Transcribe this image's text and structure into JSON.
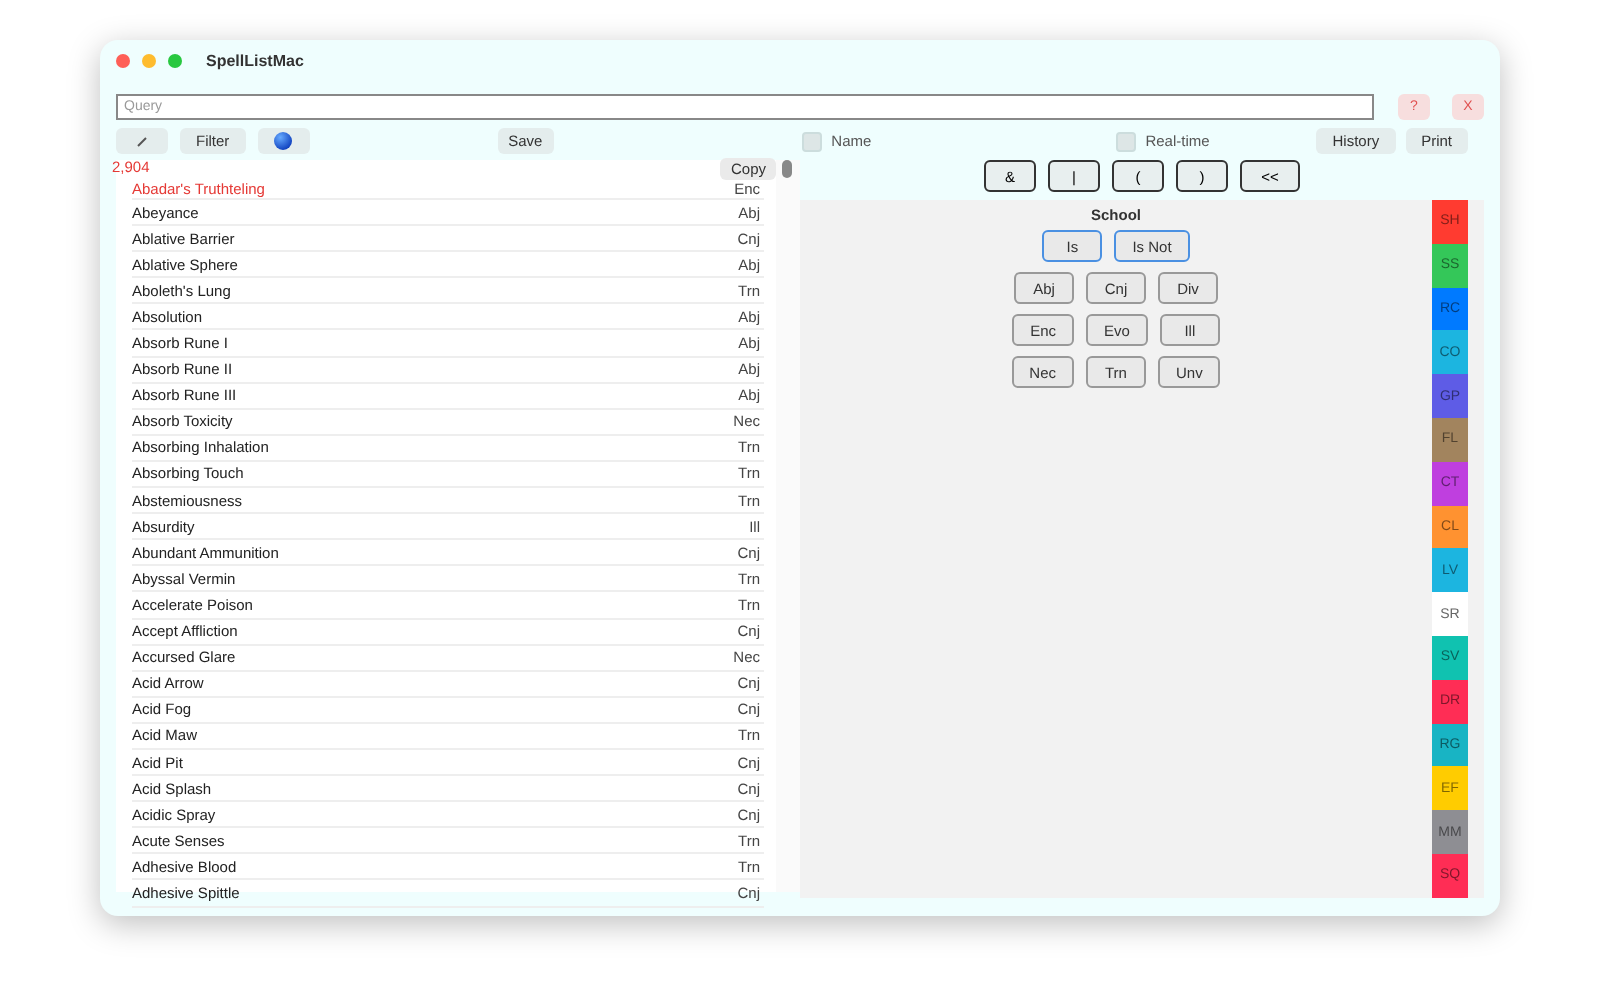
{
  "window": {
    "title": "SpellListMac"
  },
  "search": {
    "placeholder": "Query"
  },
  "search_buttons": [
    "?",
    "X"
  ],
  "toolbar": {
    "left_buttons": [
      {
        "kind": "icon"
      },
      {
        "kind": "text",
        "label": "Filter"
      },
      {
        "kind": "globe"
      }
    ],
    "save": "Save",
    "name_toggle": {
      "label": "Name",
      "checked": false
    },
    "realtime_toggle": {
      "label": "Real-time",
      "checked": false
    },
    "right_buttons": [
      "History",
      "Print"
    ]
  },
  "count": "2,904",
  "copy_button": "Copy",
  "spells": [
    {
      "name": "Abadar's Truthteling",
      "school": "Enc",
      "selected": true
    },
    {
      "name": "Abeyance",
      "school": "Abj",
      "selected": false
    },
    {
      "name": "Ablative Barrier",
      "school": "Cnj",
      "selected": false
    },
    {
      "name": "Ablative Sphere",
      "school": "Abj",
      "selected": false
    },
    {
      "name": "Aboleth's Lung",
      "school": "Trn",
      "selected": false
    },
    {
      "name": "Absolution",
      "school": "Abj",
      "selected": false
    },
    {
      "name": "Absorb Rune I",
      "school": "Abj",
      "selected": false
    },
    {
      "name": "Absorb Rune II",
      "school": "Abj",
      "selected": false
    },
    {
      "name": "Absorb Rune III",
      "school": "Abj",
      "selected": false
    },
    {
      "name": "Absorb Toxicity",
      "school": "Nec",
      "selected": false
    },
    {
      "name": "Absorbing Inhalation",
      "school": "Trn",
      "selected": false
    },
    {
      "name": "Absorbing Touch",
      "school": "Trn",
      "selected": false
    },
    {
      "name": "Abstemiousness",
      "school": "Trn",
      "selected": false
    },
    {
      "name": "Absurdity",
      "school": "Ill",
      "selected": false
    },
    {
      "name": "Abundant Ammunition",
      "school": "Cnj",
      "selected": false
    },
    {
      "name": "Abyssal Vermin",
      "school": "Trn",
      "selected": false
    },
    {
      "name": "Accelerate Poison",
      "school": "Trn",
      "selected": false
    },
    {
      "name": "Accept Affliction",
      "school": "Cnj",
      "selected": false
    },
    {
      "name": "Accursed Glare",
      "school": "Nec",
      "selected": false
    },
    {
      "name": "Acid Arrow",
      "school": "Cnj",
      "selected": false
    },
    {
      "name": "Acid Fog",
      "school": "Cnj",
      "selected": false
    },
    {
      "name": "Acid Maw",
      "school": "Trn",
      "selected": false
    },
    {
      "name": "Acid Pit",
      "school": "Cnj",
      "selected": false
    },
    {
      "name": "Acid Splash",
      "school": "Cnj",
      "selected": false
    },
    {
      "name": "Acidic Spray",
      "school": "Cnj",
      "selected": false
    },
    {
      "name": "Acute Senses",
      "school": "Trn",
      "selected": false
    },
    {
      "name": "Adhesive Blood",
      "school": "Trn",
      "selected": false
    },
    {
      "name": "Adhesive Spittle",
      "school": "Cnj",
      "selected": false
    }
  ],
  "operators": [
    "&",
    "|",
    "(",
    ")",
    "<<"
  ],
  "filter": {
    "title": "School",
    "modes": [
      "Is",
      "Is Not"
    ],
    "rows": [
      [
        "Abj",
        "Cnj",
        "Div"
      ],
      [
        "Enc",
        "Evo",
        "Ill"
      ],
      [
        "Nec",
        "Trn",
        "Unv"
      ]
    ]
  },
  "categories": [
    {
      "label": "SH",
      "color": "#ff3b30"
    },
    {
      "label": "SS",
      "color": "#34c759"
    },
    {
      "label": "RC",
      "color": "#007aff"
    },
    {
      "label": "CO",
      "color": "#1cb5e0"
    },
    {
      "label": "GP",
      "color": "#5e5ce6"
    },
    {
      "label": "FL",
      "color": "#a2845e"
    },
    {
      "label": "CT",
      "color": "#bf3fdf"
    },
    {
      "label": "CL",
      "color": "#ff9230"
    },
    {
      "label": "LV",
      "color": "#1cb5e0"
    },
    {
      "label": "SR",
      "color": "#ffffff"
    },
    {
      "label": "SV",
      "color": "#10c2b0"
    },
    {
      "label": "DR",
      "color": "#ff2d55"
    },
    {
      "label": "RG",
      "color": "#18b4c4"
    },
    {
      "label": "EF",
      "color": "#ffcc00"
    },
    {
      "label": "MM",
      "color": "#8e8e93"
    },
    {
      "label": "SQ",
      "color": "#ff2d55"
    }
  ]
}
